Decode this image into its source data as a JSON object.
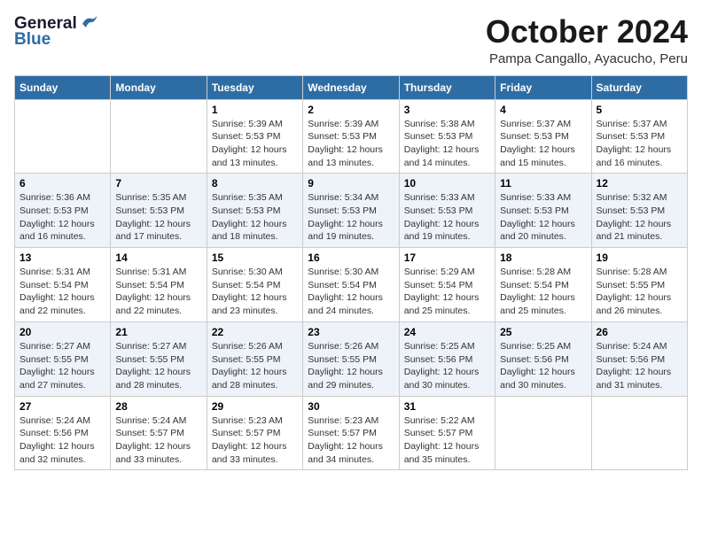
{
  "header": {
    "logo_general": "General",
    "logo_blue": "Blue",
    "month_title": "October 2024",
    "subtitle": "Pampa Cangallo, Ayacucho, Peru"
  },
  "columns": [
    "Sunday",
    "Monday",
    "Tuesday",
    "Wednesday",
    "Thursday",
    "Friday",
    "Saturday"
  ],
  "weeks": [
    [
      {
        "day": "",
        "info": ""
      },
      {
        "day": "",
        "info": ""
      },
      {
        "day": "1",
        "info": "Sunrise: 5:39 AM\nSunset: 5:53 PM\nDaylight: 12 hours and 13 minutes."
      },
      {
        "day": "2",
        "info": "Sunrise: 5:39 AM\nSunset: 5:53 PM\nDaylight: 12 hours and 13 minutes."
      },
      {
        "day": "3",
        "info": "Sunrise: 5:38 AM\nSunset: 5:53 PM\nDaylight: 12 hours and 14 minutes."
      },
      {
        "day": "4",
        "info": "Sunrise: 5:37 AM\nSunset: 5:53 PM\nDaylight: 12 hours and 15 minutes."
      },
      {
        "day": "5",
        "info": "Sunrise: 5:37 AM\nSunset: 5:53 PM\nDaylight: 12 hours and 16 minutes."
      }
    ],
    [
      {
        "day": "6",
        "info": "Sunrise: 5:36 AM\nSunset: 5:53 PM\nDaylight: 12 hours and 16 minutes."
      },
      {
        "day": "7",
        "info": "Sunrise: 5:35 AM\nSunset: 5:53 PM\nDaylight: 12 hours and 17 minutes."
      },
      {
        "day": "8",
        "info": "Sunrise: 5:35 AM\nSunset: 5:53 PM\nDaylight: 12 hours and 18 minutes."
      },
      {
        "day": "9",
        "info": "Sunrise: 5:34 AM\nSunset: 5:53 PM\nDaylight: 12 hours and 19 minutes."
      },
      {
        "day": "10",
        "info": "Sunrise: 5:33 AM\nSunset: 5:53 PM\nDaylight: 12 hours and 19 minutes."
      },
      {
        "day": "11",
        "info": "Sunrise: 5:33 AM\nSunset: 5:53 PM\nDaylight: 12 hours and 20 minutes."
      },
      {
        "day": "12",
        "info": "Sunrise: 5:32 AM\nSunset: 5:53 PM\nDaylight: 12 hours and 21 minutes."
      }
    ],
    [
      {
        "day": "13",
        "info": "Sunrise: 5:31 AM\nSunset: 5:54 PM\nDaylight: 12 hours and 22 minutes."
      },
      {
        "day": "14",
        "info": "Sunrise: 5:31 AM\nSunset: 5:54 PM\nDaylight: 12 hours and 22 minutes."
      },
      {
        "day": "15",
        "info": "Sunrise: 5:30 AM\nSunset: 5:54 PM\nDaylight: 12 hours and 23 minutes."
      },
      {
        "day": "16",
        "info": "Sunrise: 5:30 AM\nSunset: 5:54 PM\nDaylight: 12 hours and 24 minutes."
      },
      {
        "day": "17",
        "info": "Sunrise: 5:29 AM\nSunset: 5:54 PM\nDaylight: 12 hours and 25 minutes."
      },
      {
        "day": "18",
        "info": "Sunrise: 5:28 AM\nSunset: 5:54 PM\nDaylight: 12 hours and 25 minutes."
      },
      {
        "day": "19",
        "info": "Sunrise: 5:28 AM\nSunset: 5:55 PM\nDaylight: 12 hours and 26 minutes."
      }
    ],
    [
      {
        "day": "20",
        "info": "Sunrise: 5:27 AM\nSunset: 5:55 PM\nDaylight: 12 hours and 27 minutes."
      },
      {
        "day": "21",
        "info": "Sunrise: 5:27 AM\nSunset: 5:55 PM\nDaylight: 12 hours and 28 minutes."
      },
      {
        "day": "22",
        "info": "Sunrise: 5:26 AM\nSunset: 5:55 PM\nDaylight: 12 hours and 28 minutes."
      },
      {
        "day": "23",
        "info": "Sunrise: 5:26 AM\nSunset: 5:55 PM\nDaylight: 12 hours and 29 minutes."
      },
      {
        "day": "24",
        "info": "Sunrise: 5:25 AM\nSunset: 5:56 PM\nDaylight: 12 hours and 30 minutes."
      },
      {
        "day": "25",
        "info": "Sunrise: 5:25 AM\nSunset: 5:56 PM\nDaylight: 12 hours and 30 minutes."
      },
      {
        "day": "26",
        "info": "Sunrise: 5:24 AM\nSunset: 5:56 PM\nDaylight: 12 hours and 31 minutes."
      }
    ],
    [
      {
        "day": "27",
        "info": "Sunrise: 5:24 AM\nSunset: 5:56 PM\nDaylight: 12 hours and 32 minutes."
      },
      {
        "day": "28",
        "info": "Sunrise: 5:24 AM\nSunset: 5:57 PM\nDaylight: 12 hours and 33 minutes."
      },
      {
        "day": "29",
        "info": "Sunrise: 5:23 AM\nSunset: 5:57 PM\nDaylight: 12 hours and 33 minutes."
      },
      {
        "day": "30",
        "info": "Sunrise: 5:23 AM\nSunset: 5:57 PM\nDaylight: 12 hours and 34 minutes."
      },
      {
        "day": "31",
        "info": "Sunrise: 5:22 AM\nSunset: 5:57 PM\nDaylight: 12 hours and 35 minutes."
      },
      {
        "day": "",
        "info": ""
      },
      {
        "day": "",
        "info": ""
      }
    ]
  ]
}
